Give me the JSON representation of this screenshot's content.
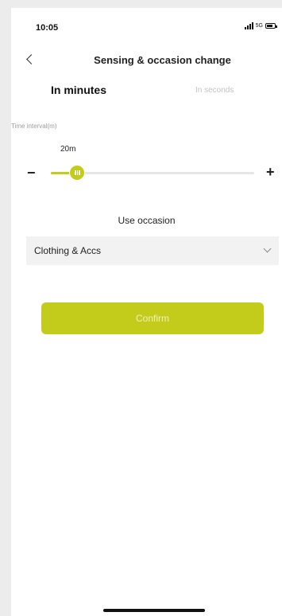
{
  "status_bar": {
    "time": "10:05",
    "network": "5G",
    "icons": [
      "signal-icon",
      "battery-icon"
    ]
  },
  "header": {
    "title": "Sensing & occasion change",
    "back_icon": "chevron-left-icon"
  },
  "mode_tabs": {
    "items": [
      {
        "label": "In minutes",
        "active": true
      },
      {
        "label": "In seconds",
        "active": false
      }
    ]
  },
  "interval": {
    "label": "Time interval(m)",
    "value_text": "20m",
    "value": 20,
    "fraction": 0.13,
    "minus": "−",
    "plus": "+"
  },
  "occasion": {
    "label": "Use occasion",
    "selected": "Clothing & Accs"
  },
  "confirm": {
    "label": "Confirm"
  },
  "colors": {
    "accent": "#c3cc1b",
    "accent_text": "#eef2b8",
    "inactive_tab": "#c4c4c4",
    "select_bg": "#f2f2f2"
  }
}
